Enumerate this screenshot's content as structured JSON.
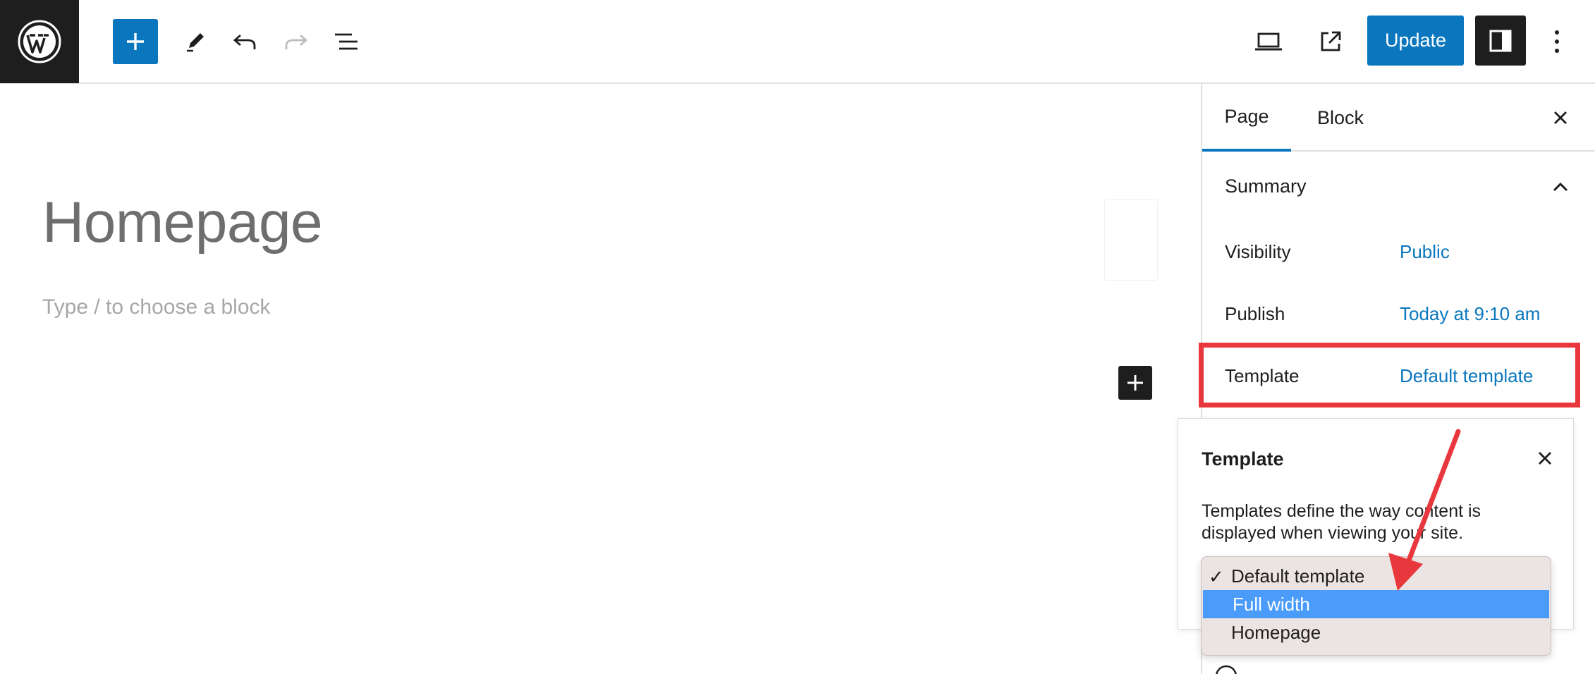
{
  "toolbar": {
    "logo_icon": "wordpress-logo",
    "inserter_icon": "plus-icon",
    "tools_icon": "pencil-icon",
    "undo_icon": "undo-icon",
    "redo_icon": "redo-icon",
    "list_view_icon": "list-view-icon",
    "preview_icon": "laptop-icon",
    "view_page_icon": "external-link-icon",
    "update_label": "Update",
    "settings_icon": "sidebar-toggle-icon",
    "more_icon": "vertical-ellipsis-icon"
  },
  "editor": {
    "title": "Homepage",
    "block_placeholder": "Type / to choose a block"
  },
  "sidebar": {
    "tabs": [
      {
        "label": "Page",
        "active": true
      },
      {
        "label": "Block",
        "active": false
      }
    ],
    "summary": {
      "heading": "Summary",
      "rows": [
        {
          "label": "Visibility",
          "value": "Public"
        },
        {
          "label": "Publish",
          "value": "Today at 9:10 am"
        },
        {
          "label": "Template",
          "value": "Default template"
        }
      ]
    }
  },
  "popover": {
    "title": "Template",
    "description": "Templates define the way content is displayed when viewing your site."
  },
  "dropdown": {
    "options": [
      {
        "label": "Default template",
        "checked": true,
        "highlighted": false
      },
      {
        "label": "Full width",
        "checked": false,
        "highlighted": true
      },
      {
        "label": "Homepage",
        "checked": false,
        "highlighted": false
      }
    ],
    "check_mark": "✓"
  },
  "colors": {
    "accent": "#0a76bd",
    "annotation_red": "#e8383d",
    "highlight_blue": "#4a9bfa"
  }
}
